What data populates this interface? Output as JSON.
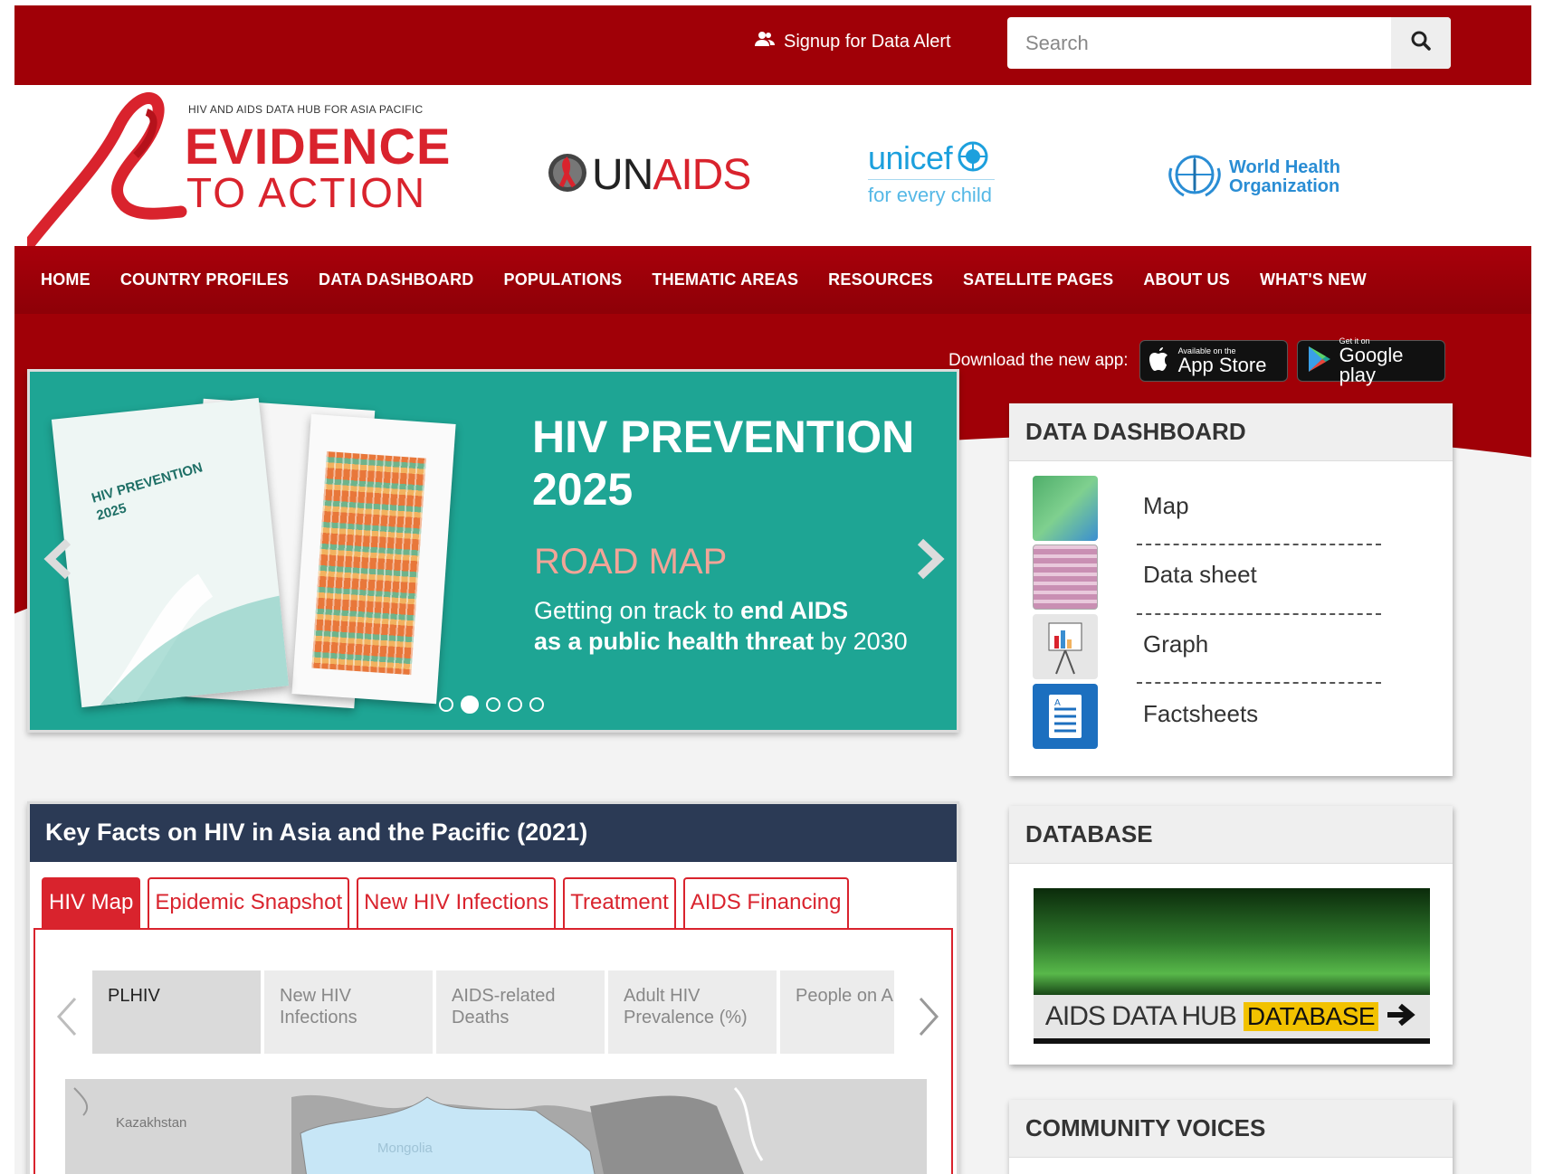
{
  "header": {
    "signup_label": "Signup for Data Alert",
    "search_placeholder": "Search"
  },
  "logos": {
    "eta_small": "HIV AND AIDS DATA HUB FOR ASIA PACIFIC",
    "eta_line1": "EVIDENCE",
    "eta_line2": "TO ACTION",
    "unaids_un": "UN",
    "unaids_aids": "AIDS",
    "unicef_name": "unicef",
    "unicef_tagline": "for every child",
    "who_line1": "World Health",
    "who_line2": "Organization"
  },
  "nav": {
    "items": [
      "HOME",
      "COUNTRY PROFILES",
      "DATA DASHBOARD",
      "POPULATIONS",
      "THEMATIC AREAS",
      "RESOURCES",
      "SATELLITE PAGES",
      "ABOUT US",
      "WHAT'S NEW"
    ]
  },
  "app_download": {
    "label": "Download the new app:",
    "appstore_small": "Available on the",
    "appstore_big": "App Store",
    "googleplay_small": "Get it on",
    "googleplay_big": "Google play"
  },
  "slider": {
    "doc_title": "HIV PREVENTION 2025",
    "title_line1": "HIV PREVENTION",
    "title_line2": "2025",
    "subtitle": "ROAD MAP",
    "text_line1_a": "Getting on track to ",
    "text_line1_b": "end AIDS",
    "text_line2_a": "as a public health threat",
    "text_line2_b": " by 2030",
    "dots_count": 5,
    "active_dot": 2
  },
  "data_dashboard": {
    "title": "DATA DASHBOARD",
    "items": [
      {
        "label": "Map",
        "icon": "map-thumbnail-icon"
      },
      {
        "label": "Data sheet",
        "icon": "datasheet-thumbnail-icon"
      },
      {
        "label": "Graph",
        "icon": "graph-thumbnail-icon"
      },
      {
        "label": "Factsheets",
        "icon": "factsheet-document-icon"
      }
    ]
  },
  "database": {
    "title": "DATABASE",
    "banner_text": "AIDS DATA HUB",
    "banner_highlight": "DATABASE"
  },
  "community_voices": {
    "title": "COMMUNITY VOICES"
  },
  "key_facts": {
    "title": "Key Facts on HIV in Asia and the Pacific (2021)",
    "tabs": [
      "HIV Map",
      "Epidemic Snapshot",
      "New HIV Infections",
      "Treatment",
      "AIDS Financing"
    ],
    "active_tab": 0,
    "subtabs": [
      "PLHIV",
      "New HIV Infections",
      "AIDS-related Deaths",
      "Adult HIV Prevalence (%)",
      "People on A"
    ],
    "active_subtab": 0,
    "map_labels": [
      "Kazakhstan",
      "Mongolia"
    ]
  },
  "colors": {
    "brand_red": "#a00007",
    "accent_red": "#d9232d",
    "slider_teal": "#1ea594",
    "keyfacts_navy": "#2b3a55"
  }
}
